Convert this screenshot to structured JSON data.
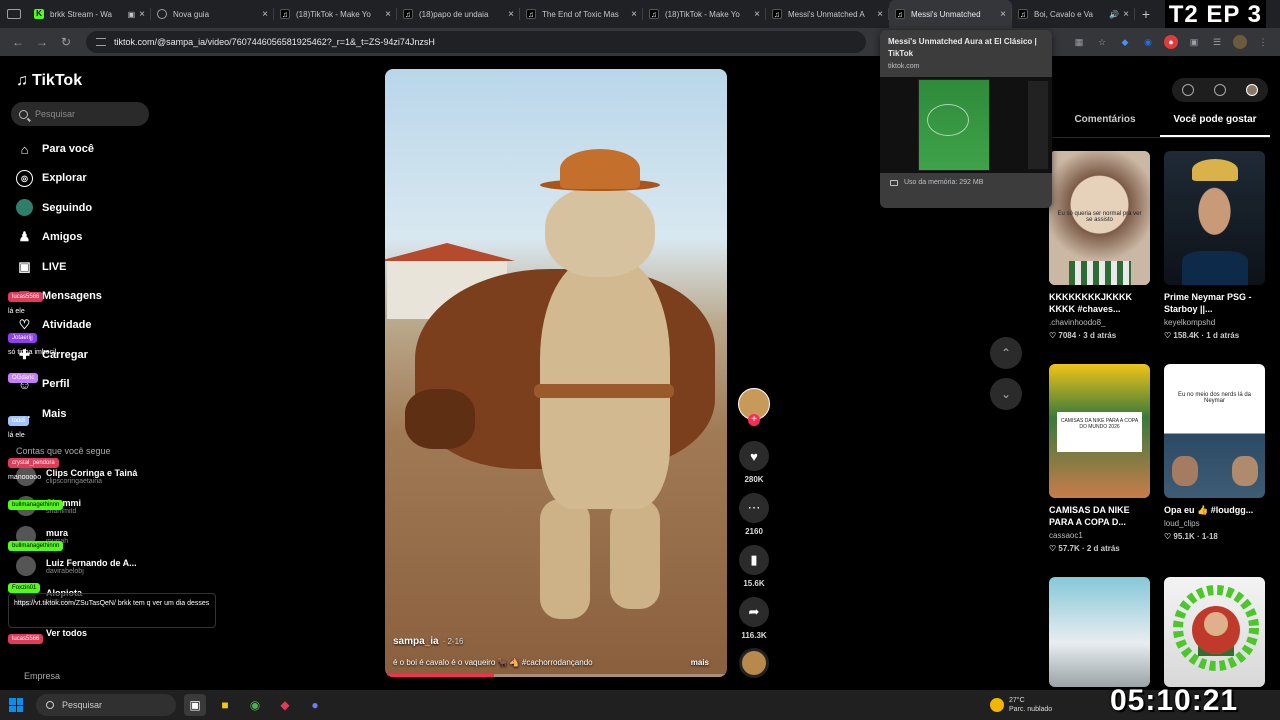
{
  "overlay_label": "T2 EP 3",
  "browser": {
    "tabs": [
      {
        "title": "brkk Stream - Wa",
        "icon": "kick",
        "extra": "▣"
      },
      {
        "title": "Nova guia",
        "icon": "globe"
      },
      {
        "title": "(18)TikTok - Make Yo",
        "icon": "tiktok"
      },
      {
        "title": "(18)papo de undaia",
        "icon": "tiktok"
      },
      {
        "title": "The End of Toxic Mas",
        "icon": "tiktok"
      },
      {
        "title": "(18)TikTok - Make Yo",
        "icon": "tiktok"
      },
      {
        "title": "Messi's Unmatched A",
        "icon": "tiktok"
      },
      {
        "title": "Messi's Unmatched",
        "icon": "tiktok",
        "active": true
      },
      {
        "title": "Boi, Cavalo e Va",
        "icon": "tiktok",
        "extra": "🔊"
      }
    ],
    "url": "tiktok.com/@sampa_ia/video/7607446056581925462?_r=1&_t=ZS-94zi74JnzsH",
    "hovercard": {
      "title": "Messi's Unmatched Aura at El Clásico | TikTok",
      "host": "tiktok.com",
      "memory": "Uso da memória: 292 MB"
    }
  },
  "tiktok": {
    "logo": "TikTok",
    "search_placeholder": "Pesquisar",
    "nav": [
      {
        "label": "Para você",
        "icon": "home-icon",
        "glyph": "⌂"
      },
      {
        "label": "Explorar",
        "icon": "compass-icon",
        "glyph": "◎"
      },
      {
        "label": "Seguindo",
        "icon": "following-avatar-icon",
        "glyph": ""
      },
      {
        "label": "Amigos",
        "icon": "friends-icon",
        "glyph": "♟"
      },
      {
        "label": "LIVE",
        "icon": "live-icon",
        "glyph": "▣"
      },
      {
        "label": "Mensagens",
        "icon": "messages-icon",
        "glyph": "✉"
      },
      {
        "label": "Atividade",
        "icon": "activity-icon",
        "glyph": "♡"
      },
      {
        "label": "Carregar",
        "icon": "upload-icon",
        "glyph": "✚"
      },
      {
        "label": "Perfil",
        "icon": "profile-icon",
        "glyph": "☺"
      },
      {
        "label": "Mais",
        "icon": "more-icon",
        "glyph": "…"
      }
    ],
    "following_header": "Contas que você segue",
    "following": [
      {
        "name": "Clips Coringa e Tainá",
        "handle": "clipscoringaetaina"
      },
      {
        "name": "Shammi",
        "handle": "shammitd"
      },
      {
        "name": "mura",
        "handle": "murrah"
      },
      {
        "name": "Luiz Fernando de A...",
        "handle": "davirabelobj"
      },
      {
        "name": "Alopiota",
        "handle": "alopiota"
      }
    ],
    "see_all": "Ver todos",
    "empresa": "Empresa",
    "video": {
      "author": "sampa_ia",
      "date": "· 2-16",
      "caption": "é o boi é cavalo é o vaqueiro 🐂 🐴 #cachorrodançando",
      "more": "mais",
      "progress": 0.32
    },
    "actions": {
      "likes": "280K",
      "comments": "2160",
      "saves": "15.6K",
      "shares": "116.3K"
    },
    "right_tabs": [
      "Comentários",
      "Você pode gostar"
    ],
    "cards": [
      {
        "title": "KKKKKKKKJKKKK KKKK #chaves...",
        "user": ".chavinhoodo8_",
        "meta": "♡ 7084 · 3 d atrás",
        "thumb_text": "Eu só queria ser normal pra ver se assisto"
      },
      {
        "title": "Prime Neymar PSG - Starboy ||...",
        "user": "keyelkompshd",
        "meta": "♡ 158.4K · 1 d atrás",
        "thumb_text": ""
      },
      {
        "title": "CAMISAS DA NIKE PARA A COPA D...",
        "user": "cassaoc1",
        "meta": "♡ 57.7K · 2 d atrás",
        "thumb_text": "CAMISAS DA NIKE PARA A COPA DO MUNDO 2026"
      },
      {
        "title": "Opa eu 👍 #loudgg...",
        "user": "loud_clips",
        "meta": "♡ 95.1K · 1-18",
        "thumb_text": "Eu no meio dos nerds lá da Neymar"
      },
      {
        "title": "",
        "user": "",
        "meta": "",
        "thumb_text": ""
      },
      {
        "title": "",
        "user": "",
        "meta": "",
        "thumb_text": ""
      }
    ]
  },
  "chat": {
    "messages": [
      {
        "user": "lucas5566",
        "text": "lá ele",
        "color": "#e23b5a"
      },
      {
        "user": "Jotaerijj",
        "text": "só tinha imbecil",
        "color": "#8f3ff0"
      },
      {
        "user": "OGdaric",
        "text": "",
        "color": "#c77dff"
      },
      {
        "user": "toddi",
        "text": "lá ele",
        "color": "#a0c4ff"
      },
      {
        "user": "crystal_pendora",
        "text": "manooooo",
        "color": "#e23b5a"
      },
      {
        "user": "bullmanagethinnn",
        "text": "",
        "color": "#53fc18"
      },
      {
        "user": "bullmanagethinnn",
        "text": "",
        "color": "#53fc18"
      },
      {
        "user": "Foxzin01",
        "text": "",
        "color": "#53fc18"
      },
      {
        "user": "lucas5566",
        "text": "",
        "color": "#e23b5a"
      }
    ],
    "link_message": "https://vt.tiktok.com/ZSuTasQeN/ brkk tem q ver um dia desses"
  },
  "taskbar": {
    "search": "Pesquisar",
    "weather_temp": "27°C",
    "weather_desc": "Parc. nublado",
    "clock": "05:10:21"
  },
  "colors": {
    "accent": "#fe2c55",
    "kick": "#53fc18",
    "background": "#000000"
  }
}
